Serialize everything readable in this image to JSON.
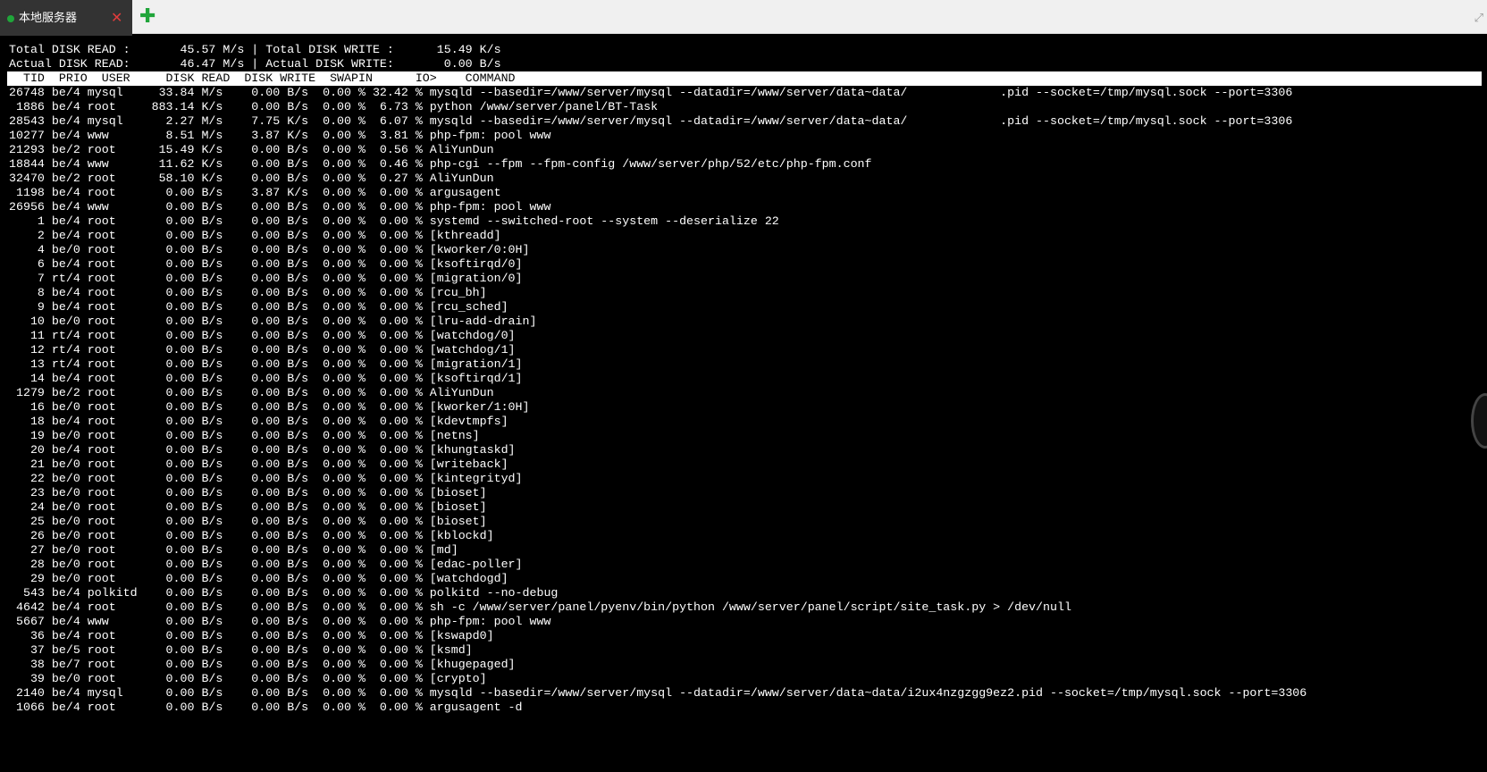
{
  "tab": {
    "title": "本地服务器",
    "close_glyph": "✕",
    "add_glyph": "✚",
    "expand_glyph": "⤢"
  },
  "colors": {
    "tab_bg": "#333333",
    "status_dot": "#20a53a",
    "close": "#e03c3c",
    "terminal_bg": "#000000",
    "terminal_fg": "#ffffff"
  },
  "summary": {
    "line1": "Total DISK READ :       45.57 M/s | Total DISK WRITE :      15.49 K/s",
    "line2": "Actual DISK READ:       46.47 M/s | Actual DISK WRITE:       0.00 B/s"
  },
  "header": "  TID  PRIO  USER     DISK READ  DISK WRITE  SWAPIN      IO>    COMMAND",
  "rows": [
    "26748 be/4 mysql     33.84 M/s    0.00 B/s  0.00 % 32.42 % mysqld --basedir=/www/server/mysql --datadir=/www/server/data~data/             .pid --socket=/tmp/mysql.sock --port=3306",
    " 1886 be/4 root     883.14 K/s    0.00 B/s  0.00 %  6.73 % python /www/server/panel/BT-Task",
    "28543 be/4 mysql      2.27 M/s    7.75 K/s  0.00 %  6.07 % mysqld --basedir=/www/server/mysql --datadir=/www/server/data~data/             .pid --socket=/tmp/mysql.sock --port=3306",
    "10277 be/4 www        8.51 M/s    3.87 K/s  0.00 %  3.81 % php-fpm: pool www",
    "21293 be/2 root      15.49 K/s    0.00 B/s  0.00 %  0.56 % AliYunDun",
    "18844 be/4 www       11.62 K/s    0.00 B/s  0.00 %  0.46 % php-cgi --fpm --fpm-config /www/server/php/52/etc/php-fpm.conf",
    "32470 be/2 root      58.10 K/s    0.00 B/s  0.00 %  0.27 % AliYunDun",
    " 1198 be/4 root       0.00 B/s    3.87 K/s  0.00 %  0.00 % argusagent",
    "26956 be/4 www        0.00 B/s    0.00 B/s  0.00 %  0.00 % php-fpm: pool www",
    "    1 be/4 root       0.00 B/s    0.00 B/s  0.00 %  0.00 % systemd --switched-root --system --deserialize 22",
    "    2 be/4 root       0.00 B/s    0.00 B/s  0.00 %  0.00 % [kthreadd]",
    "    4 be/0 root       0.00 B/s    0.00 B/s  0.00 %  0.00 % [kworker/0:0H]",
    "    6 be/4 root       0.00 B/s    0.00 B/s  0.00 %  0.00 % [ksoftirqd/0]",
    "    7 rt/4 root       0.00 B/s    0.00 B/s  0.00 %  0.00 % [migration/0]",
    "    8 be/4 root       0.00 B/s    0.00 B/s  0.00 %  0.00 % [rcu_bh]",
    "    9 be/4 root       0.00 B/s    0.00 B/s  0.00 %  0.00 % [rcu_sched]",
    "   10 be/0 root       0.00 B/s    0.00 B/s  0.00 %  0.00 % [lru-add-drain]",
    "   11 rt/4 root       0.00 B/s    0.00 B/s  0.00 %  0.00 % [watchdog/0]",
    "   12 rt/4 root       0.00 B/s    0.00 B/s  0.00 %  0.00 % [watchdog/1]",
    "   13 rt/4 root       0.00 B/s    0.00 B/s  0.00 %  0.00 % [migration/1]",
    "   14 be/4 root       0.00 B/s    0.00 B/s  0.00 %  0.00 % [ksoftirqd/1]",
    " 1279 be/2 root       0.00 B/s    0.00 B/s  0.00 %  0.00 % AliYunDun",
    "   16 be/0 root       0.00 B/s    0.00 B/s  0.00 %  0.00 % [kworker/1:0H]",
    "   18 be/4 root       0.00 B/s    0.00 B/s  0.00 %  0.00 % [kdevtmpfs]",
    "   19 be/0 root       0.00 B/s    0.00 B/s  0.00 %  0.00 % [netns]",
    "   20 be/4 root       0.00 B/s    0.00 B/s  0.00 %  0.00 % [khungtaskd]",
    "   21 be/0 root       0.00 B/s    0.00 B/s  0.00 %  0.00 % [writeback]",
    "   22 be/0 root       0.00 B/s    0.00 B/s  0.00 %  0.00 % [kintegrityd]",
    "   23 be/0 root       0.00 B/s    0.00 B/s  0.00 %  0.00 % [bioset]",
    "   24 be/0 root       0.00 B/s    0.00 B/s  0.00 %  0.00 % [bioset]",
    "   25 be/0 root       0.00 B/s    0.00 B/s  0.00 %  0.00 % [bioset]",
    "   26 be/0 root       0.00 B/s    0.00 B/s  0.00 %  0.00 % [kblockd]",
    "   27 be/0 root       0.00 B/s    0.00 B/s  0.00 %  0.00 % [md]",
    "   28 be/0 root       0.00 B/s    0.00 B/s  0.00 %  0.00 % [edac-poller]",
    "   29 be/0 root       0.00 B/s    0.00 B/s  0.00 %  0.00 % [watchdogd]",
    "  543 be/4 polkitd    0.00 B/s    0.00 B/s  0.00 %  0.00 % polkitd --no-debug",
    " 4642 be/4 root       0.00 B/s    0.00 B/s  0.00 %  0.00 % sh -c /www/server/panel/pyenv/bin/python /www/server/panel/script/site_task.py > /dev/null",
    " 5667 be/4 www        0.00 B/s    0.00 B/s  0.00 %  0.00 % php-fpm: pool www",
    "   36 be/4 root       0.00 B/s    0.00 B/s  0.00 %  0.00 % [kswapd0]",
    "   37 be/5 root       0.00 B/s    0.00 B/s  0.00 %  0.00 % [ksmd]",
    "   38 be/7 root       0.00 B/s    0.00 B/s  0.00 %  0.00 % [khugepaged]",
    "   39 be/0 root       0.00 B/s    0.00 B/s  0.00 %  0.00 % [crypto]",
    " 2140 be/4 mysql      0.00 B/s    0.00 B/s  0.00 %  0.00 % mysqld --basedir=/www/server/mysql --datadir=/www/server/data~data/i2ux4nzgzgg9ez2.pid --socket=/tmp/mysql.sock --port=3306",
    " 1066 be/4 root       0.00 B/s    0.00 B/s  0.00 %  0.00 % argusagent -d"
  ]
}
